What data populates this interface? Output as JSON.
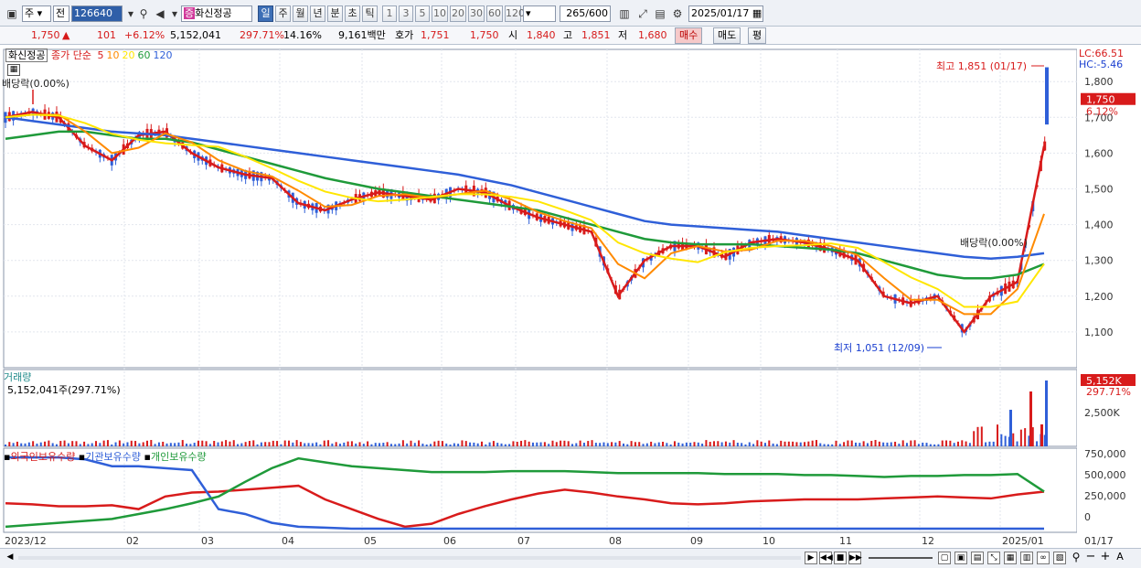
{
  "toolbar": {
    "period_select": "주",
    "period_value": "전",
    "stock_code": "126640",
    "stock_badge": "증",
    "stock_name": "화신정공",
    "tabs": [
      "일",
      "주",
      "월",
      "년",
      "분",
      "초",
      "틱"
    ],
    "active_tab": "일",
    "intervals": [
      "1",
      "3",
      "5",
      "10",
      "20",
      "30",
      "60",
      "120"
    ],
    "count": "265",
    "count_total": "/600",
    "date": "2025/01/17"
  },
  "quote": {
    "price": "1,750",
    "arrow": "▲",
    "change": "101",
    "change_pct": "+6.12%",
    "volume": "5,152,041",
    "volume_pct": "297.71%",
    "turnover": "14.16%",
    "amount": "9,161백만",
    "bid_label": "호가",
    "bid1": "1,751",
    "bid2": "1,750",
    "open_label": "시",
    "open": "1,840",
    "high_label": "고",
    "high": "1,851",
    "low_label": "저",
    "low": "1,680",
    "buy_btn": "매수",
    "sell_btn": "매도",
    "avg_btn": "평"
  },
  "legend": {
    "price_box": "화신정공",
    "ma_label": "종가 단순",
    "ma_periods": [
      "5",
      "10",
      "20",
      "60",
      "120"
    ],
    "ma_colors": [
      "#d81b1b",
      "#ff8a00",
      "#ffe600",
      "#1f9a3a",
      "#2f5fd8"
    ],
    "volume_title": "거래량",
    "volume_value": "5,152,041주(297.71%)",
    "holding_foreign": "외국인보유수량",
    "holding_inst": "기관보유수량",
    "holding_indiv": "개인보유수량",
    "lc": "LC:66.51",
    "hc": "HC:-5.46"
  },
  "annotations": {
    "high_note": "최고 1,851 (01/17)",
    "low_note": "최저 1,051 (12/09)",
    "div1": "배당락(0.00%)",
    "div2": "배당락(0.00%)",
    "price_tag": "1,750",
    "pct_tag": "6.12%",
    "vol_tag": "5,152K",
    "vol_pct_tag": "297.71%"
  },
  "chart_data": {
    "type": "line",
    "price_axis": {
      "ticks": [
        "1,800",
        "1,700",
        "1,600",
        "1,500",
        "1,400",
        "1,300",
        "1,200",
        "1,100"
      ],
      "ylim": [
        1000,
        1890
      ]
    },
    "volume_axis": {
      "ticks": [
        "2,500K"
      ]
    },
    "holding_axis": {
      "ticks": [
        "750,000",
        "500,000",
        "250,000",
        "0"
      ]
    },
    "x_labels": [
      "2023/12",
      "02",
      "03",
      "04",
      "05",
      "06",
      "07",
      "08",
      "09",
      "10",
      "11",
      "12",
      "2025/01",
      "01/17"
    ],
    "series": [
      {
        "name": "종가 단순 5",
        "color": "#d81b1b",
        "values": [
          1700,
          1715,
          1700,
          1620,
          1580,
          1650,
          1660,
          1600,
          1560,
          1540,
          1530,
          1460,
          1440,
          1470,
          1490,
          1480,
          1470,
          1500,
          1490,
          1450,
          1420,
          1400,
          1380,
          1200,
          1300,
          1340,
          1340,
          1310,
          1350,
          1360,
          1350,
          1330,
          1300,
          1200,
          1180,
          1200,
          1100,
          1200,
          1240,
          1620
        ]
      },
      {
        "name": "종가 단순 60",
        "color": "#1f9a3a",
        "values": [
          1640,
          1650,
          1660,
          1660,
          1650,
          1640,
          1640,
          1630,
          1610,
          1590,
          1570,
          1550,
          1530,
          1515,
          1500,
          1490,
          1480,
          1470,
          1460,
          1450,
          1440,
          1420,
          1400,
          1380,
          1360,
          1350,
          1345,
          1345,
          1345,
          1340,
          1335,
          1330,
          1320,
          1300,
          1280,
          1260,
          1250,
          1250,
          1260,
          1290
        ]
      },
      {
        "name": "종가 단순 120",
        "color": "#2f5fd8",
        "values": [
          1700,
          1690,
          1680,
          1670,
          1660,
          1655,
          1650,
          1640,
          1630,
          1620,
          1610,
          1600,
          1590,
          1580,
          1570,
          1560,
          1550,
          1540,
          1525,
          1510,
          1490,
          1470,
          1450,
          1430,
          1410,
          1400,
          1395,
          1390,
          1385,
          1380,
          1370,
          1360,
          1350,
          1340,
          1330,
          1320,
          1310,
          1305,
          1310,
          1320
        ]
      }
    ]
  }
}
